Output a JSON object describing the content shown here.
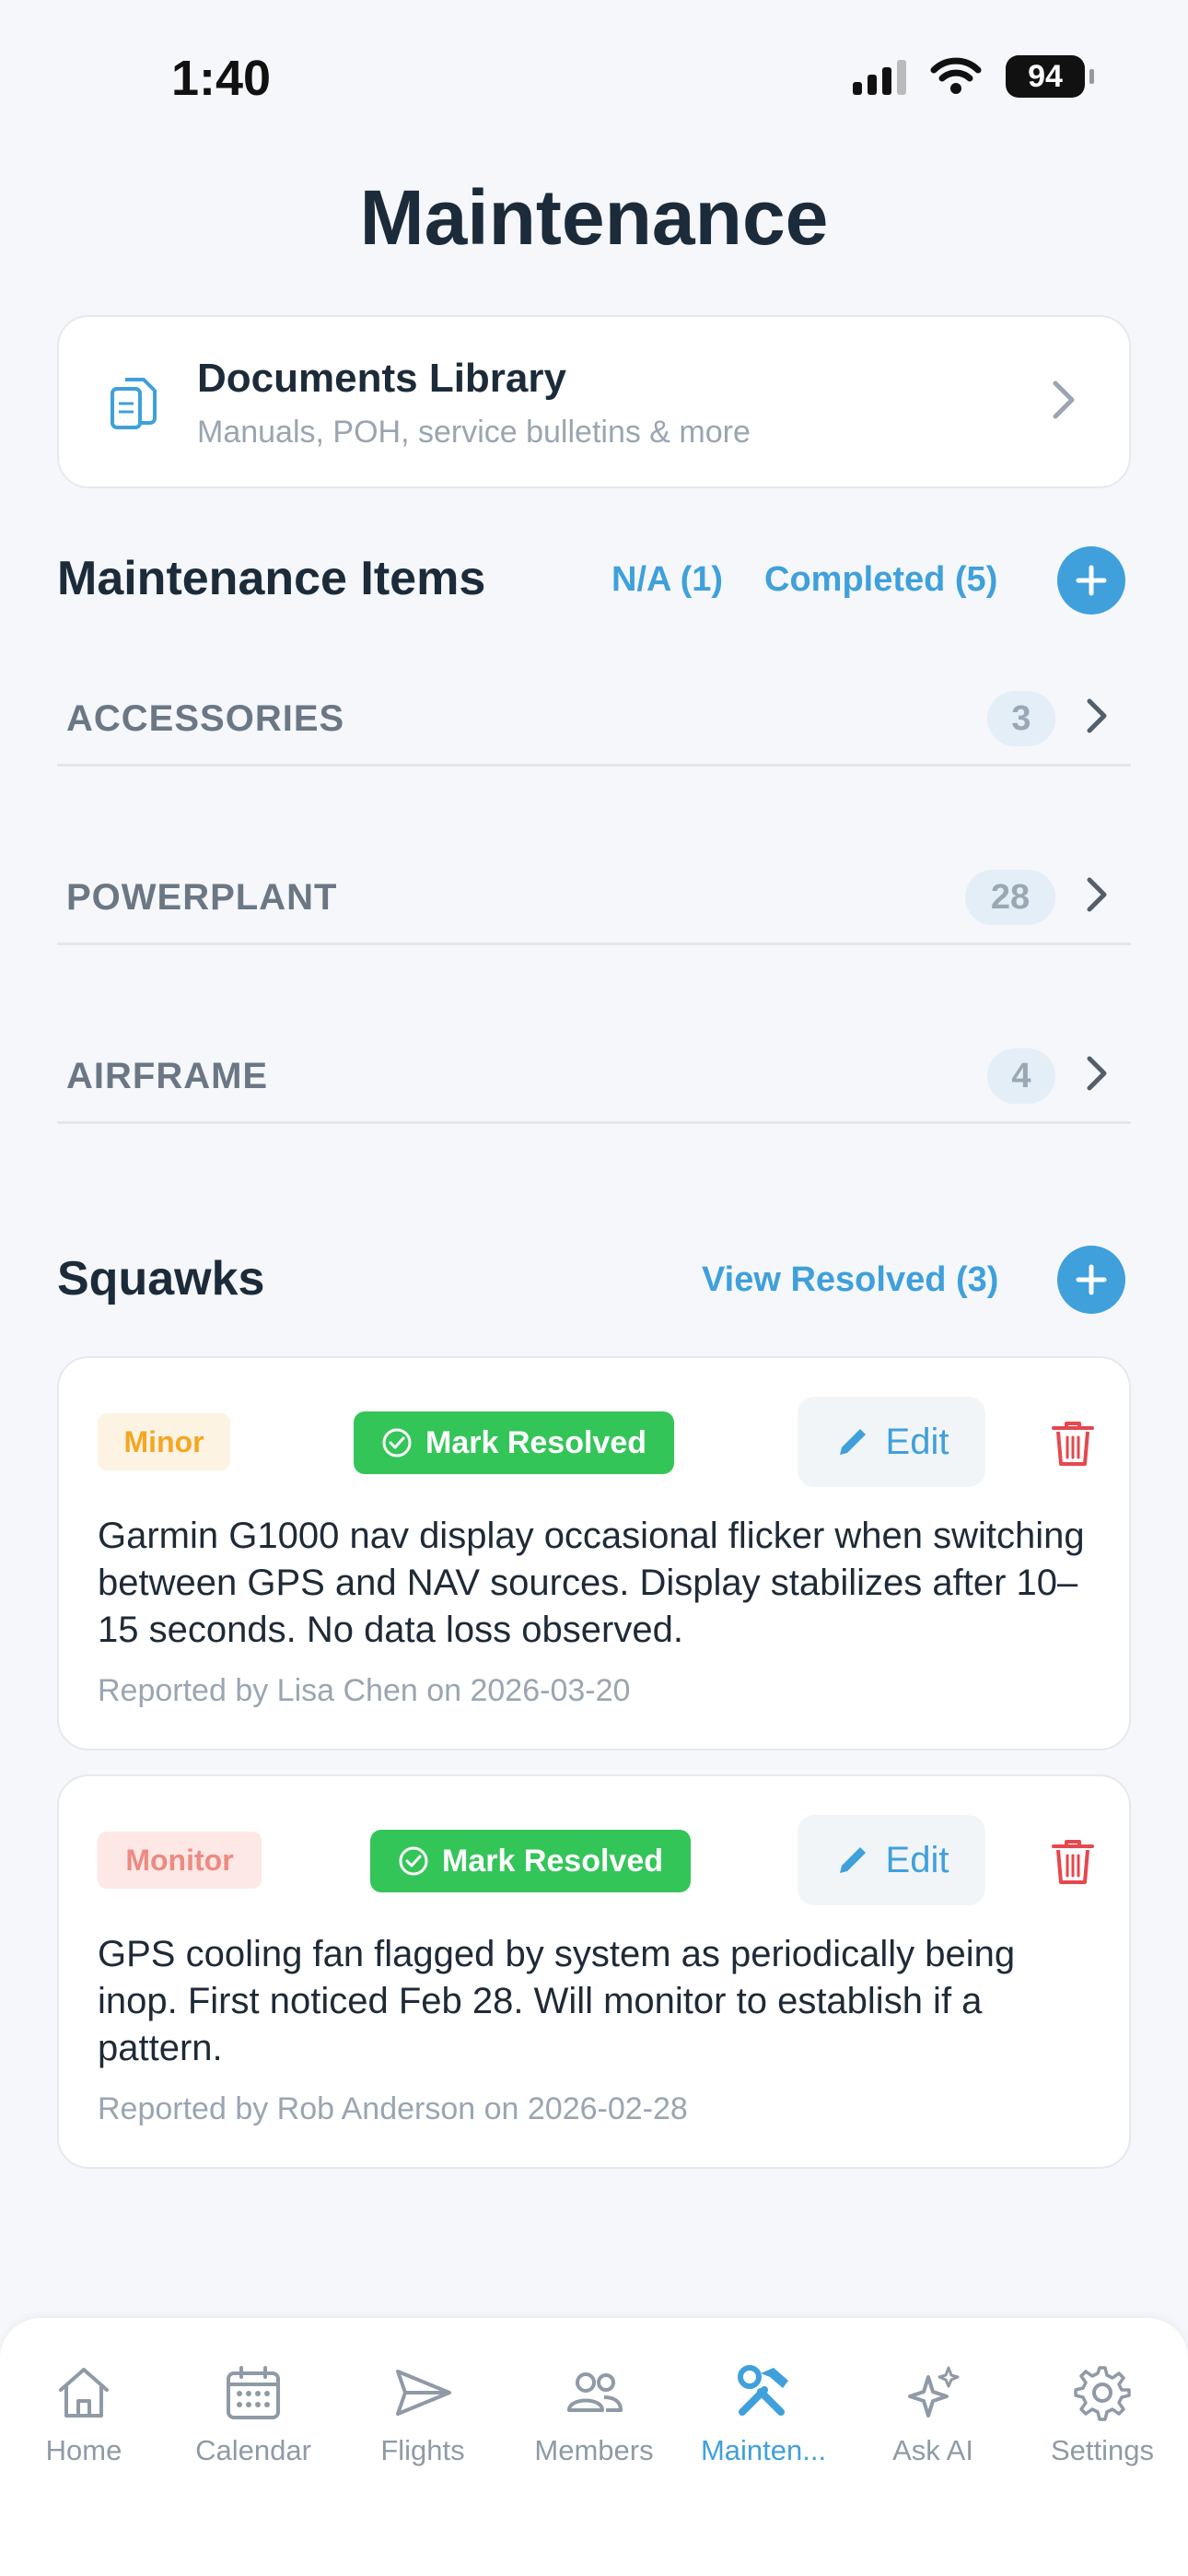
{
  "status_bar": {
    "time": "1:40",
    "battery": "94"
  },
  "page": {
    "title": "Maintenance"
  },
  "documents": {
    "title": "Documents Library",
    "subtitle": "Manuals, POH, service bulletins & more"
  },
  "maintenance": {
    "title": "Maintenance Items",
    "na_link": "N/A (1)",
    "completed_link": "Completed (5)",
    "categories": [
      {
        "label": "ACCESSORIES",
        "count": "3"
      },
      {
        "label": "POWERPLANT",
        "count": "28"
      },
      {
        "label": "AIRFRAME",
        "count": "4"
      }
    ]
  },
  "squawks": {
    "title": "Squawks",
    "view_resolved": "View Resolved (3)",
    "mark_resolved_label": "Mark Resolved",
    "edit_label": "Edit",
    "items": [
      {
        "severity": "Minor",
        "severity_color": "#f5a623",
        "severity_bg": "#fdf3e3",
        "description": "Garmin G1000 nav display occasional flicker when switching between GPS and NAV sources. Display stabilizes after 10–15 seconds. No data loss observed.",
        "reported": "Reported by Lisa Chen on 2026-03-20"
      },
      {
        "severity": "Monitor",
        "severity_color": "#ee8a82",
        "severity_bg": "#fde8e6",
        "description": "GPS cooling fan flagged by system as periodically being inop. First noticed Feb 28. Will monitor to establish if a pattern.",
        "reported": "Reported by Rob Anderson on 2026-02-28"
      }
    ]
  },
  "tabs": [
    {
      "label": "Home",
      "icon": "home-icon"
    },
    {
      "label": "Calendar",
      "icon": "calendar-icon"
    },
    {
      "label": "Flights",
      "icon": "paper-plane-icon"
    },
    {
      "label": "Members",
      "icon": "members-icon"
    },
    {
      "label": "Mainten...",
      "icon": "wrench-hammer-icon",
      "active": true
    },
    {
      "label": "Ask AI",
      "icon": "sparkles-icon"
    },
    {
      "label": "Settings",
      "icon": "gear-icon"
    }
  ],
  "colors": {
    "accent": "#3fa0dc",
    "resolve": "#34c559",
    "danger": "#e5484d"
  }
}
